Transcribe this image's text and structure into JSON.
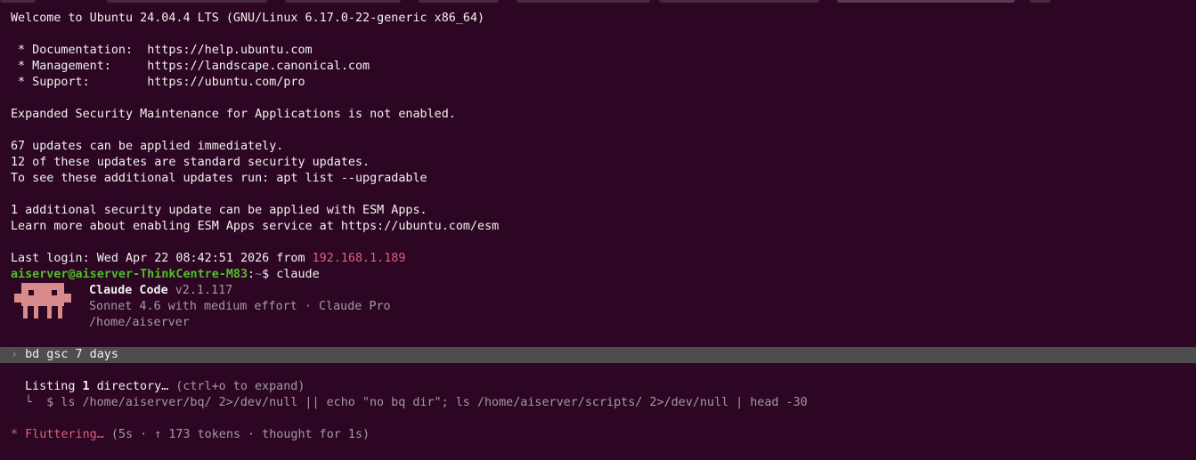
{
  "welcome": "Welcome to Ubuntu 24.04.4 LTS (GNU/Linux 6.17.0-22-generic x86_64)",
  "links": [
    {
      "label": " * Documentation:  ",
      "url": "https://help.ubuntu.com"
    },
    {
      "label": " * Management:     ",
      "url": "https://landscape.canonical.com"
    },
    {
      "label": " * Support:        ",
      "url": "https://ubuntu.com/pro"
    }
  ],
  "esm_notice": "Expanded Security Maintenance for Applications is not enabled.",
  "updates": [
    "67 updates can be applied immediately.",
    "12 of these updates are standard security updates.",
    "To see these additional updates run: apt list --upgradable"
  ],
  "esm_apps": [
    "1 additional security update can be applied with ESM Apps.",
    "Learn more about enabling ESM Apps service at https://ubuntu.com/esm"
  ],
  "last_login": {
    "text": "Last login: Wed Apr 22 08:42:51 2026 from ",
    "ip": "192.168.1.189"
  },
  "prompt": {
    "user_host": "aiserver@aiserver-ThinkCentre-M83",
    "sep": ":",
    "path": "~",
    "symbol": "$ ",
    "command": "claude"
  },
  "claude": {
    "name": "Claude Code",
    "version": " v2.1.117",
    "model_line": "Sonnet 4.6 with medium effort · Claude Pro",
    "cwd": "/home/aiserver"
  },
  "input_row": {
    "chevron": "›",
    "text": " bd gsc 7 days"
  },
  "tool": {
    "prefix": "Listing ",
    "count": "1",
    "rest": " directory…",
    "hint": " (ctrl+o to expand)",
    "branch": "└",
    "command": "  $ ls /home/aiserver/bq/ 2>/dev/null || echo \"no bq dir\"; ls /home/aiserver/scripts/ 2>/dev/null | head -30"
  },
  "status": {
    "star": "*",
    "verb": " Fluttering…",
    "detail": " (5s · ↑ 173 tokens · thought for 1s)"
  },
  "colors": {
    "background": "#2c0622",
    "prompt_green": "#4fbf2a",
    "path_blue": "#6b8cd6",
    "accent_pink": "#e0607e",
    "mascot": "#d98b8b"
  }
}
